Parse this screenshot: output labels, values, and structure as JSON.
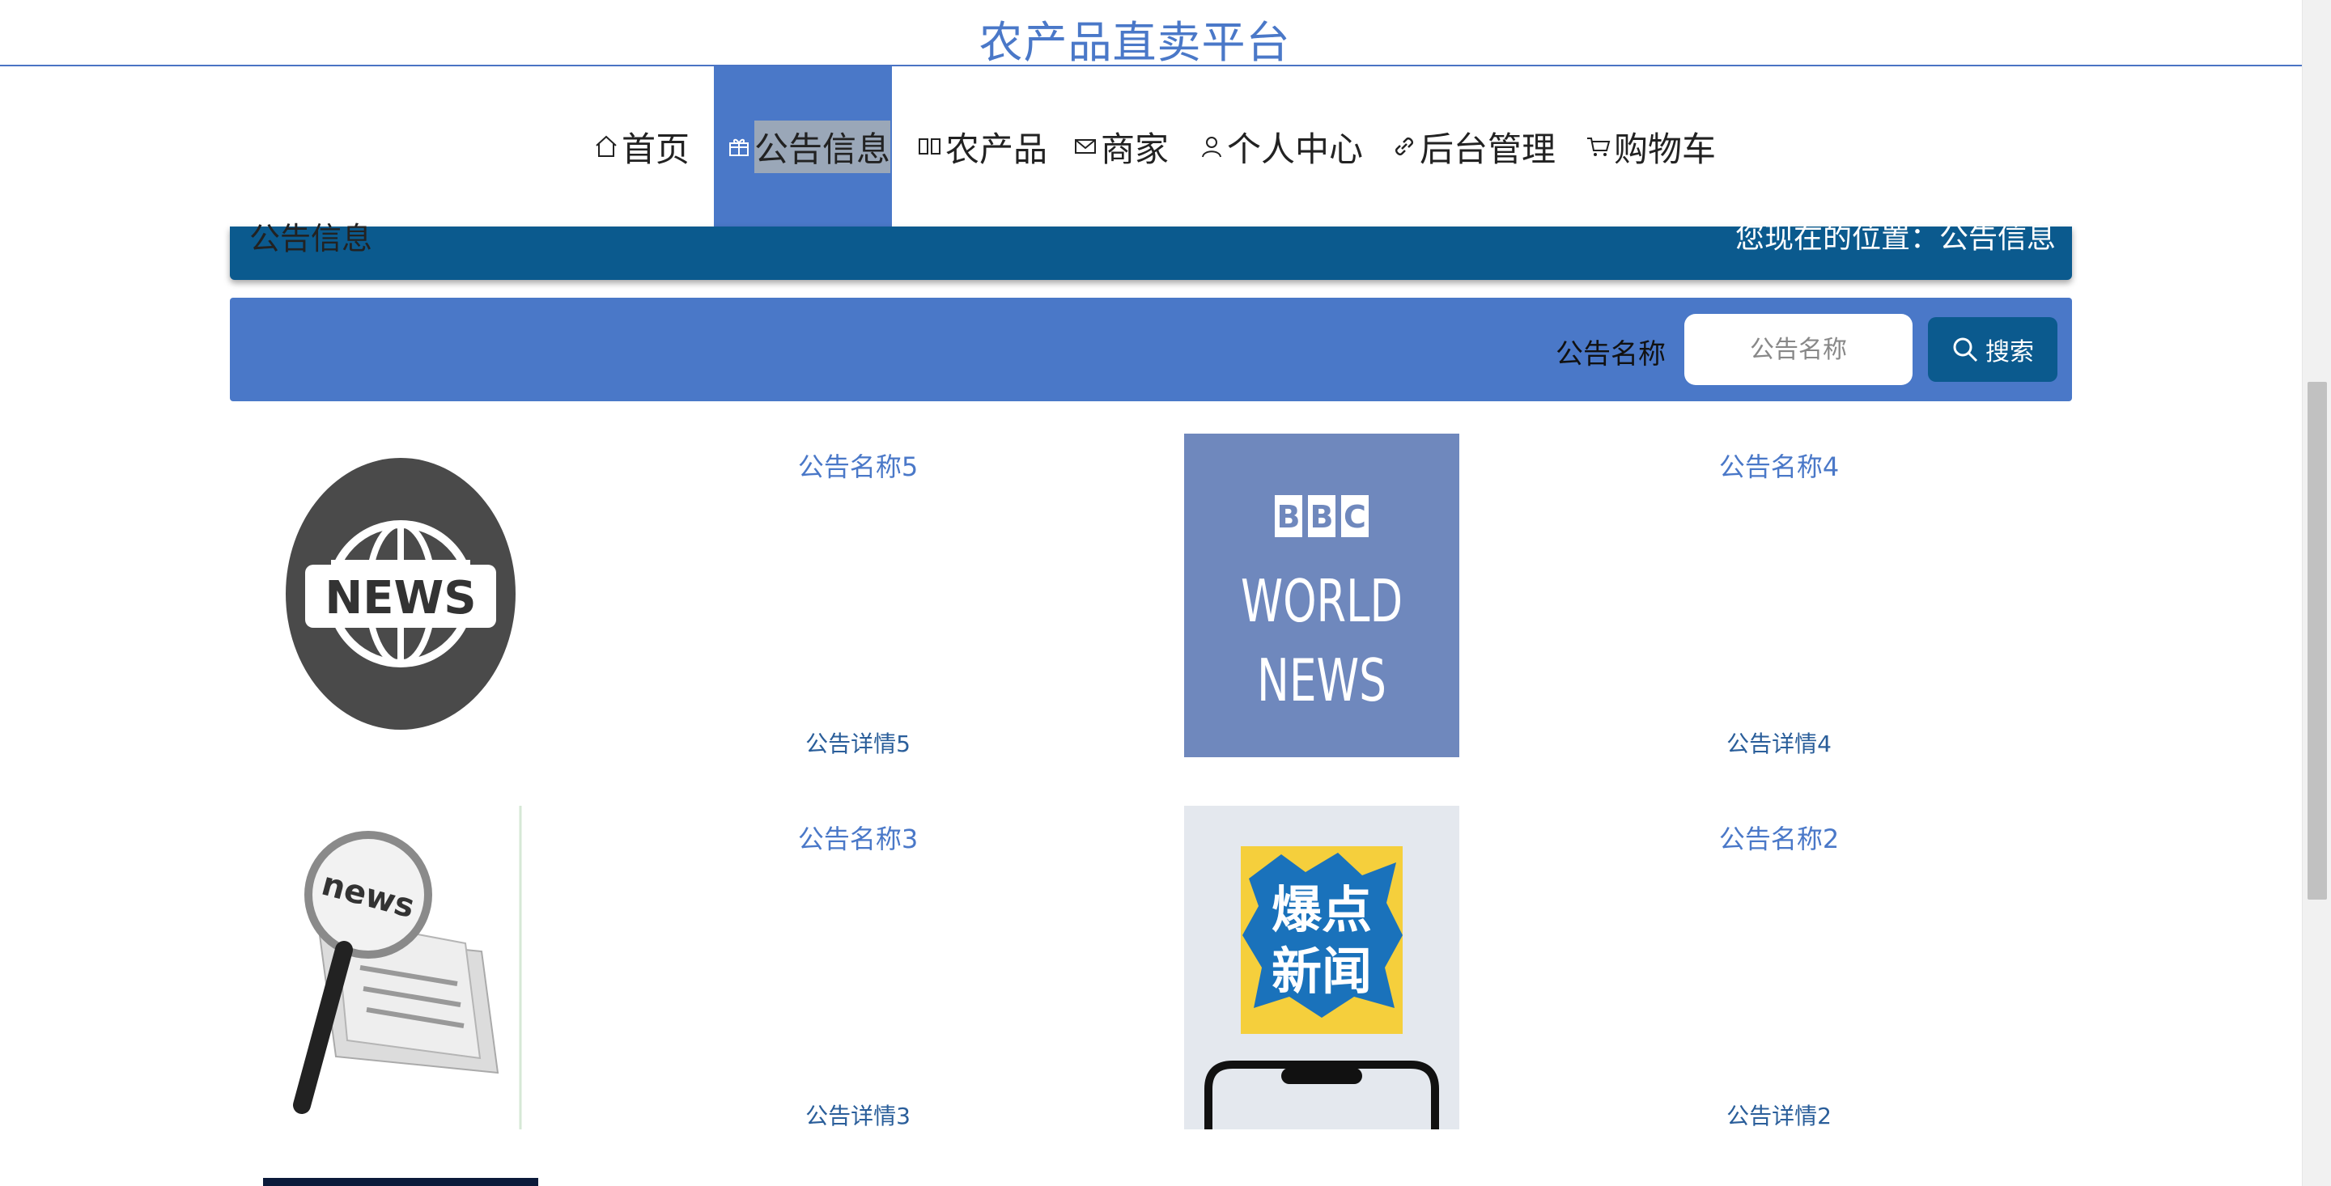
{
  "header": {
    "title": "农产品直卖平台"
  },
  "nav": {
    "items": [
      {
        "label": "首页",
        "icon": "home-icon"
      },
      {
        "label": "公告信息",
        "icon": "gift-icon",
        "active": true
      },
      {
        "label": "农产品",
        "icon": "columns-icon"
      },
      {
        "label": "商家",
        "icon": "mail-icon"
      },
      {
        "label": "个人中心",
        "icon": "user-icon"
      },
      {
        "label": "后台管理",
        "icon": "link-icon"
      },
      {
        "label": "购物车",
        "icon": "cart-icon"
      }
    ]
  },
  "crumb": {
    "title": "公告信息",
    "location": "您现在的位置：公告信息"
  },
  "search": {
    "label": "公告名称",
    "placeholder": "公告名称",
    "button": "搜索"
  },
  "notices": [
    {
      "name": "公告名称5",
      "detail": "公告详情5",
      "image": "news-globe-image"
    },
    {
      "name": "公告名称4",
      "detail": "公告详情4",
      "image": "bbc-world-news-image"
    },
    {
      "name": "公告名称3",
      "detail": "公告详情3",
      "image": "newspaper-magnifier-image"
    },
    {
      "name": "公告名称2",
      "detail": "公告详情2",
      "image": "hot-news-poster-image"
    }
  ],
  "colors": {
    "accent": "#4a78c8",
    "dark": "#0b5a8e"
  }
}
